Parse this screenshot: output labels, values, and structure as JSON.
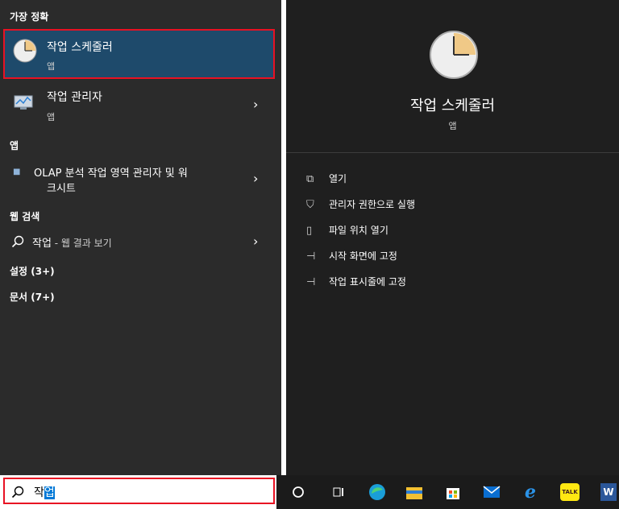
{
  "left": {
    "best_header": "가장 정확",
    "best": {
      "title": "작업 스케줄러",
      "subtitle": "앱"
    },
    "task_manager": {
      "title": "작업 관리자",
      "subtitle": "앱"
    },
    "apps_header": "앱",
    "olap": {
      "line1": "OLAP 분석 작업 영역 관리자 및 워",
      "line2": "크시트"
    },
    "web_header": "웹 검색",
    "web_item": {
      "title": "작업",
      "suffix": " - 웹 결과 보기"
    },
    "settings_header": "설정 (3+)",
    "docs_header": "문서 (7+)"
  },
  "right": {
    "title": "작업 스케줄러",
    "subtitle": "앱",
    "actions": [
      {
        "icon": "open-icon",
        "label": "열기"
      },
      {
        "icon": "admin-shield-icon",
        "label": "관리자 권한으로 실행"
      },
      {
        "icon": "file-location-icon",
        "label": "파일 위치 열기"
      },
      {
        "icon": "pin-icon",
        "label": "시작 화면에 고정"
      },
      {
        "icon": "pin-icon",
        "label": "작업 표시줄에 고정"
      }
    ]
  },
  "search": {
    "value_prefix": "작",
    "value_selected": "업"
  },
  "taskbar": {
    "icons": [
      "cortana-icon",
      "task-view-icon",
      "edge-icon",
      "file-explorer-icon",
      "store-icon",
      "mail-icon",
      "ie-icon",
      "kakaotalk-icon",
      "word-icon"
    ],
    "kakaotalk_label": "TALK",
    "word_label": "W"
  },
  "colors": {
    "accent": "#1e4a6b",
    "highlight_border": "#e81123",
    "selection": "#0078d7"
  }
}
